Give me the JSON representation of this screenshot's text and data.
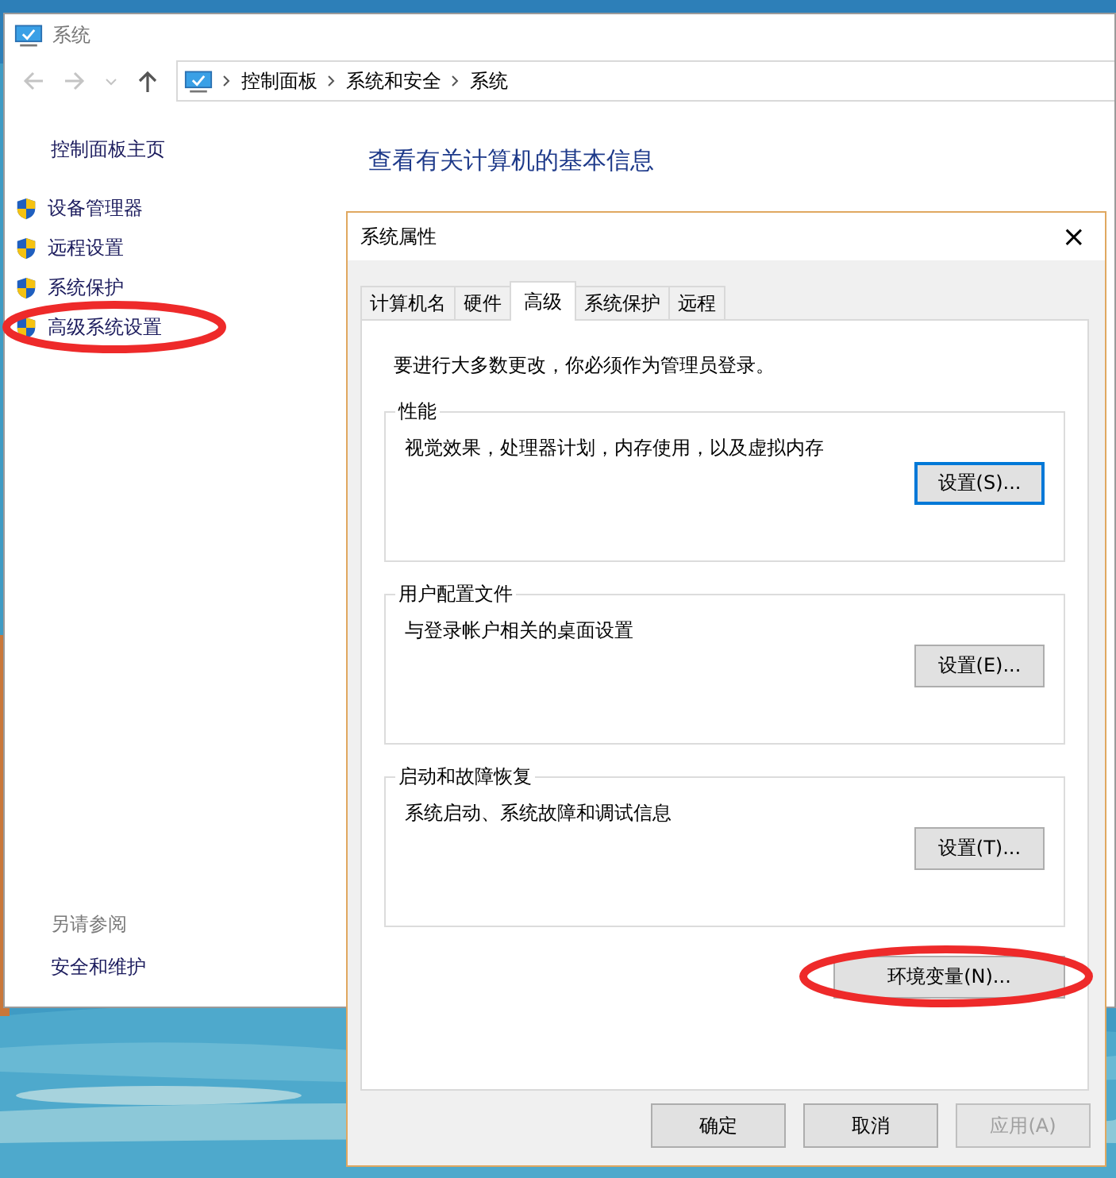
{
  "window": {
    "title": "系统"
  },
  "breadcrumbs": [
    "控制面板",
    "系统和安全",
    "系统"
  ],
  "sidebar": {
    "home": "控制面板主页",
    "items": [
      {
        "label": "设备管理器",
        "highlighted": false
      },
      {
        "label": "远程设置",
        "highlighted": false
      },
      {
        "label": "系统保护",
        "highlighted": false
      },
      {
        "label": "高级系统设置",
        "highlighted": true
      }
    ],
    "see_also_heading": "另请参阅",
    "see_also": [
      "安全和维护"
    ]
  },
  "main": {
    "heading": "查看有关计算机的基本信息"
  },
  "dialog": {
    "title": "系统属性",
    "close": "×",
    "tabs": [
      {
        "label": "计算机名",
        "selected": false
      },
      {
        "label": "硬件",
        "selected": false
      },
      {
        "label": "高级",
        "selected": true
      },
      {
        "label": "系统保护",
        "selected": false
      },
      {
        "label": "远程",
        "selected": false
      }
    ],
    "notice": "要进行大多数更改，你必须作为管理员登录。",
    "groups": [
      {
        "title": "性能",
        "text": "视觉效果，处理器计划，内存使用，以及虚拟内存",
        "button": "设置(S)...",
        "focused": true
      },
      {
        "title": "用户配置文件",
        "text": "与登录帐户相关的桌面设置",
        "button": "设置(E)...",
        "focused": false
      },
      {
        "title": "启动和故障恢复",
        "text": "系统启动、系统故障和调试信息",
        "button": "设置(T)...",
        "focused": false
      }
    ],
    "env_button": {
      "label": "环境变量(N)...",
      "highlighted": true
    },
    "buttons": [
      {
        "label": "确定",
        "disabled": false
      },
      {
        "label": "取消",
        "disabled": false
      },
      {
        "label": "应用(A)",
        "disabled": true
      }
    ]
  }
}
